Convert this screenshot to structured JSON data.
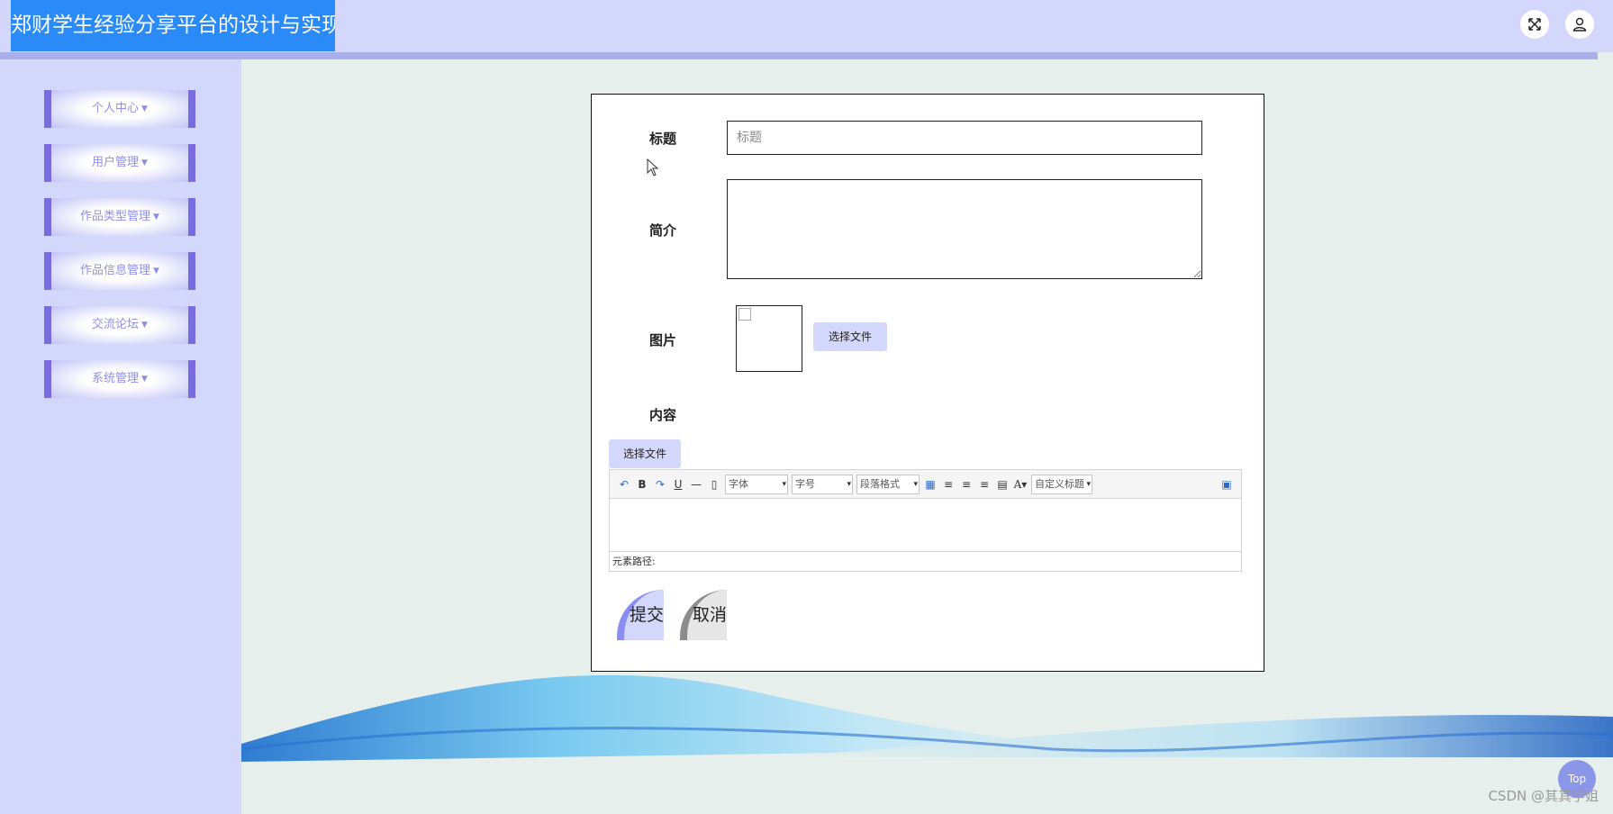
{
  "header": {
    "title": "郑财学生经验分享平台的设计与实现",
    "icons": [
      "fullscreen-icon",
      "user-icon"
    ]
  },
  "sidebar": {
    "items": [
      {
        "label": "个人中心"
      },
      {
        "label": "用户管理"
      },
      {
        "label": "作品类型管理"
      },
      {
        "label": "作品信息管理"
      },
      {
        "label": "交流论坛"
      },
      {
        "label": "系统管理"
      }
    ]
  },
  "form": {
    "title_label": "标题",
    "title_placeholder": "标题",
    "title_value": "",
    "intro_label": "简介",
    "intro_value": "",
    "image_label": "图片",
    "image_file_button": "选择文件",
    "content_label": "内容",
    "content_file_button": "选择文件",
    "editor": {
      "font_combo": "字体",
      "size_combo": "字号",
      "paragraph_combo": "段落格式",
      "custom_title_combo": "自定义标题",
      "status_path": "元素路径:"
    },
    "submit_label": "提交",
    "cancel_label": "取消"
  },
  "footer": {
    "top_button": "Top",
    "watermark": "CSDN @其其学姐"
  },
  "colors": {
    "header_bg": "#d3d7fb",
    "title_bg": "#2a8af7",
    "menu_accent": "#7b6be0",
    "main_bg": "#e6efec"
  }
}
